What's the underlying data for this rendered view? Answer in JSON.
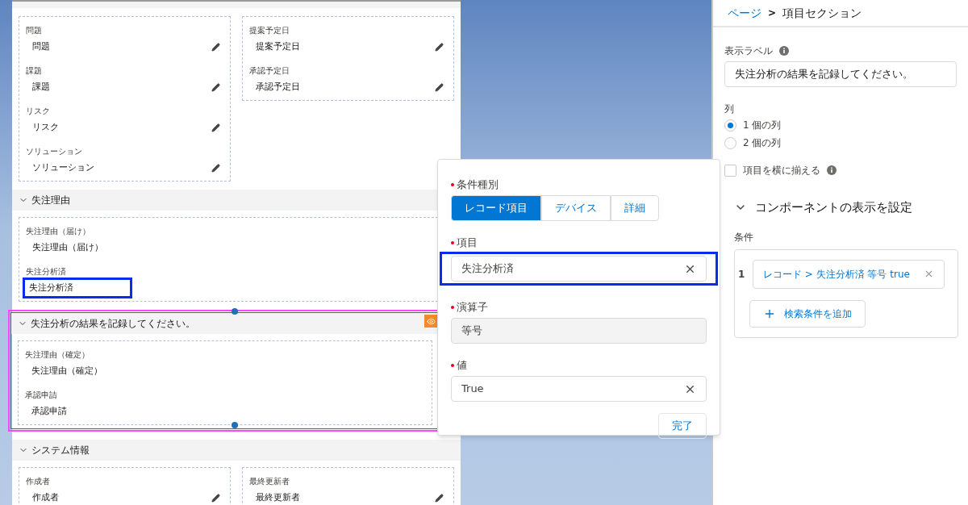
{
  "record_page": {
    "top_group": {
      "columns": [
        [
          {
            "label": "問題",
            "value": "問題",
            "editable": true,
            "highlighted": false
          },
          {
            "label": "課題",
            "value": "課題",
            "editable": true,
            "highlighted": false
          },
          {
            "label": "リスク",
            "value": "リスク",
            "editable": true,
            "highlighted": false
          },
          {
            "label": "ソリューション",
            "value": "ソリューション",
            "editable": true,
            "highlighted": false
          }
        ],
        [
          {
            "label": "提案予定日",
            "value": "提案予定日",
            "editable": true,
            "highlighted": false
          },
          {
            "label": "承認予定日",
            "value": "承認予定日",
            "editable": true,
            "highlighted": false
          }
        ]
      ]
    },
    "sections": [
      {
        "title": "失注理由",
        "selected": false,
        "has_visibility_rule": false,
        "columns": [
          [
            {
              "label": "失注理由（届け）",
              "value": "失注理由（届け）",
              "editable": false,
              "highlighted": false
            },
            {
              "label": "失注分析済",
              "value": "失注分析済",
              "editable": false,
              "highlighted": true
            }
          ]
        ]
      },
      {
        "title": "失注分析の結果を記録してください。",
        "selected": true,
        "has_visibility_rule": true,
        "columns": [
          [
            {
              "label": "失注理由（確定）",
              "value": "失注理由（確定）",
              "editable": false,
              "highlighted": false
            },
            {
              "label": "承認申請",
              "value": "承認申請",
              "editable": false,
              "highlighted": false
            }
          ]
        ]
      },
      {
        "title": "システム情報",
        "selected": false,
        "has_visibility_rule": false,
        "columns": [
          [
            {
              "label": "作成者",
              "value": "作成者",
              "editable": true,
              "highlighted": false
            }
          ],
          [
            {
              "label": "最終更新者",
              "value": "最終更新者",
              "editable": true,
              "highlighted": false
            }
          ]
        ]
      }
    ]
  },
  "condition_popover": {
    "type_label": "条件種別",
    "type_required": true,
    "type_options": [
      {
        "label": "レコード項目",
        "selected": true
      },
      {
        "label": "デバイス",
        "selected": false
      },
      {
        "label": "詳細",
        "selected": false
      }
    ],
    "fields": [
      {
        "label": "項目",
        "value": "失注分析済",
        "required": true,
        "kind": "clearable",
        "highlighted": true
      },
      {
        "label": "演算子",
        "value": "等号",
        "required": true,
        "kind": "readonly",
        "highlighted": false
      },
      {
        "label": "値",
        "value": "True",
        "required": true,
        "kind": "clearable",
        "highlighted": false
      }
    ],
    "done_button": "完了"
  },
  "properties_panel": {
    "breadcrumb": [
      {
        "label": "ページ",
        "kind": "link"
      },
      {
        "label": "項目セクション",
        "kind": "current"
      }
    ],
    "breadcrumb_separator": ">",
    "display_label": {
      "label": "表示ラベル",
      "value": "失注分析の結果を記録してください。"
    },
    "columns": {
      "label": "列",
      "options": [
        {
          "label": "1 個の列",
          "selected": true
        },
        {
          "label": "2 個の列",
          "selected": false
        }
      ]
    },
    "align_fields": {
      "label": "項目を横に揃える",
      "checked": false
    },
    "visibility": {
      "title": "コンポーネントの表示を設定",
      "expanded": true,
      "conditions_label": "条件",
      "conditions": [
        {
          "number": "1",
          "text": "レコード > 失注分析済 等号 true"
        }
      ],
      "add_button": "検索条件を追加"
    }
  }
}
